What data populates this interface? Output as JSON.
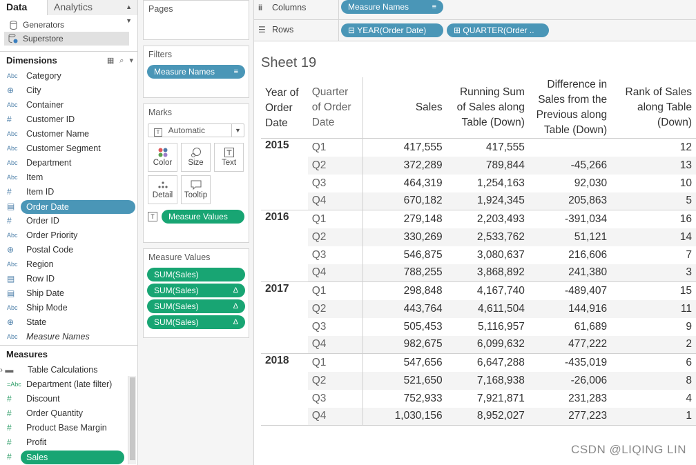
{
  "data_pane": {
    "tabs": [
      {
        "label": "Data"
      },
      {
        "label": "Analytics"
      }
    ],
    "data_sources": [
      {
        "label": "Generators",
        "selected": false
      },
      {
        "label": "Superstore",
        "selected": true
      }
    ],
    "dimensions_header": "Dimensions",
    "dimensions": [
      {
        "type": "Abc",
        "label": "Category"
      },
      {
        "type": "geo",
        "label": "City"
      },
      {
        "type": "Abc",
        "label": "Container"
      },
      {
        "type": "#",
        "label": "Customer ID"
      },
      {
        "type": "Abc",
        "label": "Customer Name"
      },
      {
        "type": "Abc",
        "label": "Customer Segment"
      },
      {
        "type": "Abc",
        "label": "Department"
      },
      {
        "type": "Abc",
        "label": "Item"
      },
      {
        "type": "#",
        "label": "Item ID"
      },
      {
        "type": "date",
        "label": "Order Date",
        "selected": true
      },
      {
        "type": "#",
        "label": "Order ID"
      },
      {
        "type": "Abc",
        "label": "Order Priority"
      },
      {
        "type": "geo",
        "label": "Postal Code"
      },
      {
        "type": "Abc",
        "label": "Region"
      },
      {
        "type": "date",
        "label": "Row ID"
      },
      {
        "type": "date",
        "label": "Ship Date"
      },
      {
        "type": "Abc",
        "label": "Ship Mode"
      },
      {
        "type": "geo",
        "label": "State"
      },
      {
        "type": "Abc",
        "label": "Measure Names",
        "italic": true
      }
    ],
    "measures_header": "Measures",
    "measures": [
      {
        "type": "folder",
        "label": "Table Calculations"
      },
      {
        "type": "=Abc",
        "label": "Department (late filter)"
      },
      {
        "type": "#",
        "label": "Discount"
      },
      {
        "type": "#",
        "label": "Order Quantity"
      },
      {
        "type": "#",
        "label": "Product Base Margin"
      },
      {
        "type": "#",
        "label": "Profit"
      },
      {
        "type": "#",
        "label": "Sales",
        "selected": true
      }
    ]
  },
  "cards": {
    "pages": {
      "title": "Pages"
    },
    "filters": {
      "title": "Filters",
      "pills": [
        "Measure Names"
      ]
    },
    "marks": {
      "title": "Marks",
      "mark_type": "Automatic",
      "buttons": [
        "Color",
        "Size",
        "Text",
        "Detail",
        "Tooltip"
      ],
      "pills": [
        "Measure Values"
      ]
    },
    "measure_values": {
      "title": "Measure Values",
      "pills": [
        "SUM(Sales)",
        "SUM(Sales)",
        "SUM(Sales)",
        "SUM(Sales)"
      ],
      "delta_symbol": "Δ"
    }
  },
  "shelves": {
    "columns": {
      "label": "Columns",
      "pills": [
        "Measure Names"
      ]
    },
    "rows": {
      "label": "Rows",
      "pills": [
        "YEAR(Order Date)",
        "QUARTER(Order .."
      ],
      "expand_symbol": "⊟",
      "collapse_symbol": "⊞"
    }
  },
  "view": {
    "sheet_title": "Sheet 19",
    "headers": [
      "Year of Order Date",
      "Quarter of Order Date",
      "Sales",
      "Running Sum of Sales along Table (Down)",
      "Difference in Sales from the Previous along Table (Down)",
      "Rank of Sales along Table (Down)"
    ],
    "years": [
      {
        "year": "2015",
        "quarters": [
          {
            "q": "Q1",
            "sales": "417,555",
            "running": "417,555",
            "diff": "",
            "rank": "12"
          },
          {
            "q": "Q2",
            "sales": "372,289",
            "running": "789,844",
            "diff": "-45,266",
            "rank": "13"
          },
          {
            "q": "Q3",
            "sales": "464,319",
            "running": "1,254,163",
            "diff": "92,030",
            "rank": "10"
          },
          {
            "q": "Q4",
            "sales": "670,182",
            "running": "1,924,345",
            "diff": "205,863",
            "rank": "5"
          }
        ]
      },
      {
        "year": "2016",
        "quarters": [
          {
            "q": "Q1",
            "sales": "279,148",
            "running": "2,203,493",
            "diff": "-391,034",
            "rank": "16"
          },
          {
            "q": "Q2",
            "sales": "330,269",
            "running": "2,533,762",
            "diff": "51,121",
            "rank": "14"
          },
          {
            "q": "Q3",
            "sales": "546,875",
            "running": "3,080,637",
            "diff": "216,606",
            "rank": "7"
          },
          {
            "q": "Q4",
            "sales": "788,255",
            "running": "3,868,892",
            "diff": "241,380",
            "rank": "3"
          }
        ]
      },
      {
        "year": "2017",
        "quarters": [
          {
            "q": "Q1",
            "sales": "298,848",
            "running": "4,167,740",
            "diff": "-489,407",
            "rank": "15"
          },
          {
            "q": "Q2",
            "sales": "443,764",
            "running": "4,611,504",
            "diff": "144,916",
            "rank": "11"
          },
          {
            "q": "Q3",
            "sales": "505,453",
            "running": "5,116,957",
            "diff": "61,689",
            "rank": "9"
          },
          {
            "q": "Q4",
            "sales": "982,675",
            "running": "6,099,632",
            "diff": "477,222",
            "rank": "2"
          }
        ]
      },
      {
        "year": "2018",
        "quarters": [
          {
            "q": "Q1",
            "sales": "547,656",
            "running": "6,647,288",
            "diff": "-435,019",
            "rank": "6"
          },
          {
            "q": "Q2",
            "sales": "521,650",
            "running": "7,168,938",
            "diff": "-26,006",
            "rank": "8"
          },
          {
            "q": "Q3",
            "sales": "752,933",
            "running": "7,921,871",
            "diff": "231,283",
            "rank": "4"
          },
          {
            "q": "Q4",
            "sales": "1,030,156",
            "running": "8,952,027",
            "diff": "277,223",
            "rank": "1"
          }
        ]
      }
    ]
  },
  "watermark": "CSDN @LIQING LIN",
  "colors": {
    "dimension_pill": "#4a96b7",
    "measure_pill": "#18a573",
    "row_band": "#f4f4f4"
  }
}
